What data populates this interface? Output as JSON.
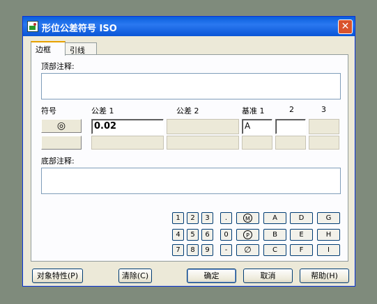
{
  "window": {
    "title": "形位公差符号 ISO",
    "close_label": "✕"
  },
  "tabs": [
    {
      "label": "边框"
    },
    {
      "label": "引线"
    }
  ],
  "form": {
    "top_note_label": "顶部注释:",
    "symbol_label": "符号",
    "tol1_label": "公差 1",
    "tol2_label": "公差 2",
    "datum1_label": "基准 1",
    "datum2_label": "2",
    "datum3_label": "3",
    "symbol_glyph": "◎",
    "tol1_value": "0.02",
    "datum1_value": "A",
    "bottom_note_label": "底部注释:"
  },
  "keypad": {
    "row1": [
      "1",
      "2",
      "3",
      "."
    ],
    "row2": [
      "4",
      "5",
      "6",
      "0"
    ],
    "row3": [
      "7",
      "8",
      "9",
      "-"
    ],
    "modifiers": [
      "M",
      "P",
      "∅"
    ],
    "letters_row1": [
      "A",
      "D",
      "G"
    ],
    "letters_row2": [
      "B",
      "E",
      "H"
    ],
    "letters_row3": [
      "C",
      "F",
      "I"
    ]
  },
  "buttons": {
    "properties": "对象特性(P)",
    "clear": "清除(C)",
    "ok": "确定",
    "cancel": "取消",
    "help": "帮助(H)"
  }
}
